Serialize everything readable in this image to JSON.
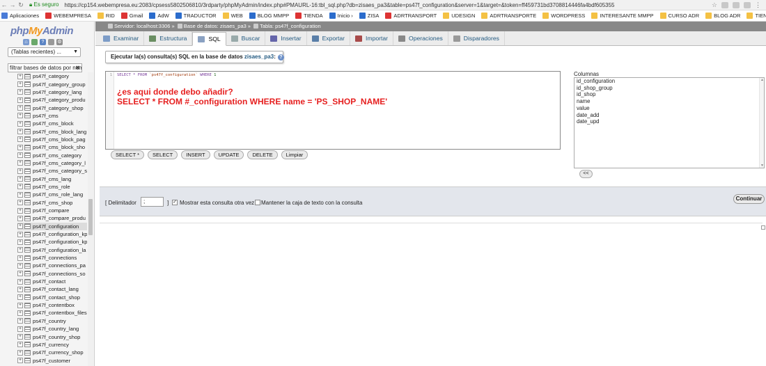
{
  "browser": {
    "secure_label": "Es seguro",
    "url": "https://cp154.webempresa.eu:2083/cpsess5802506810/3rdparty/phpMyAdmin/index.php#PMAURL-16:tbl_sql.php?db=zisaes_pa3&table=ps47f_configuration&server=1&target=&token=ff459731bd3708814446fa4bdf605355",
    "bookmarks": [
      {
        "label": "Aplicaciones",
        "icon": "apps-icon"
      },
      {
        "label": "WEBEMPRESA",
        "icon": "webempresa-icon"
      },
      {
        "label": "RID",
        "icon": "folder-icon"
      },
      {
        "label": "Gmail",
        "icon": "gmail-icon"
      },
      {
        "label": "AdW",
        "icon": "adwords-icon"
      },
      {
        "label": "TRADUCTOR",
        "icon": "translate-icon"
      },
      {
        "label": "WEB",
        "icon": "folder-icon"
      },
      {
        "label": "BLOG MMPP",
        "icon": "wordpress-icon"
      },
      {
        "label": "TIENDA",
        "icon": "prestashop-icon"
      },
      {
        "label": "Inicio ›",
        "icon": "home-icon"
      },
      {
        "label": "ZISA",
        "icon": "zisa-icon"
      },
      {
        "label": "ADRTRANSPORT",
        "icon": "adr-icon"
      },
      {
        "label": "UDESIGN",
        "icon": "folder-icon"
      },
      {
        "label": "ADRTRANSPORTE",
        "icon": "folder-icon"
      },
      {
        "label": "WORDPRESS",
        "icon": "folder-icon"
      },
      {
        "label": "INTERESANTE MMPP",
        "icon": "folder-icon"
      },
      {
        "label": "CURSO ADR",
        "icon": "folder-icon"
      },
      {
        "label": "BLOG ADR",
        "icon": "folder-icon"
      },
      {
        "label": "TIENDA ADR",
        "icon": "folder-icon"
      }
    ]
  },
  "sidebar": {
    "logo_php": "php",
    "logo_my": "My",
    "logo_admin": "Admin",
    "recent_label": "(Tablas recientes) ...",
    "filter_value": "filtrar bases de datos por nom",
    "tables": [
      "ps47f_category",
      "ps47f_category_group",
      "ps47f_category_lang",
      "ps47f_category_produ",
      "ps47f_category_shop",
      "ps47f_cms",
      "ps47f_cms_block",
      "ps47f_cms_block_lang",
      "ps47f_cms_block_pag",
      "ps47f_cms_block_sho",
      "ps47f_cms_category",
      "ps47f_cms_category_l",
      "ps47f_cms_category_s",
      "ps47f_cms_lang",
      "ps47f_cms_role",
      "ps47f_cms_role_lang",
      "ps47f_cms_shop",
      "ps47f_compare",
      "ps47f_compare_produ",
      "ps47f_configuration",
      "ps47f_configuration_kp",
      "ps47f_configuration_kp",
      "ps47f_configuration_la",
      "ps47f_connections",
      "ps47f_connections_pa",
      "ps47f_connections_so",
      "ps47f_contact",
      "ps47f_contact_lang",
      "ps47f_contact_shop",
      "ps47f_contentbox",
      "ps47f_contentbox_files",
      "ps47f_country",
      "ps47f_country_lang",
      "ps47f_country_shop",
      "ps47f_currency",
      "ps47f_currency_shop",
      "ps47f_customer"
    ],
    "selected_index": 19
  },
  "breadcrumb": {
    "server": "Servidor: localhost:3306",
    "database": "Base de datos: zisaes_pa3",
    "table": "Tabla: ps47f_configuration"
  },
  "tabs": [
    {
      "label": "Examinar",
      "icon": "browse-icon",
      "active": false
    },
    {
      "label": "Estructura",
      "icon": "structure-icon",
      "active": false
    },
    {
      "label": "SQL",
      "icon": "sql-icon",
      "active": true
    },
    {
      "label": "Buscar",
      "icon": "search-icon",
      "active": false
    },
    {
      "label": "Insertar",
      "icon": "insert-icon",
      "active": false
    },
    {
      "label": "Exportar",
      "icon": "export-icon",
      "active": false
    },
    {
      "label": "Importar",
      "icon": "import-icon",
      "active": false
    },
    {
      "label": "Operaciones",
      "icon": "wrench-icon",
      "active": false
    },
    {
      "label": "Disparadores",
      "icon": "triggers-icon",
      "active": false
    }
  ],
  "sql": {
    "heading_prefix": "Ejecutar la(s) consulta(s) SQL en la base de datos ",
    "heading_db": "zisaes_pa3",
    "heading_suffix": ":",
    "line_number": "1",
    "query_select": "SELECT * FROM ",
    "query_table": "`ps47f_configuration`",
    "query_where": " WHERE ",
    "query_value": "1",
    "note_line1": "¿es aqui donde debo añadir?",
    "note_line2": "SELECT * FROM #_configuration WHERE name = 'PS_SHOP_NAME'",
    "buttons": [
      "SELECT *",
      "SELECT",
      "INSERT",
      "UPDATE",
      "DELETE",
      "Limpiar"
    ],
    "columns_label": "Columnas",
    "columns": [
      "id_configuration",
      "id_shop_group",
      "id_shop",
      "name",
      "value",
      "date_add",
      "date_upd"
    ],
    "insert_column_btn": "<<"
  },
  "options": {
    "delimiter_label": "[ Delimitador",
    "delimiter_value": ";",
    "delimiter_close": "]",
    "show_again_label": "Mostrar esta consulta otra vez",
    "show_again_checked": true,
    "keep_box_label": "Mantener la caja de texto con la consulta",
    "keep_box_checked": false,
    "continue_label": "Continuar"
  },
  "colors": {
    "link_blue": "#235a81",
    "note_red": "#e62020",
    "breadcrumb_bg": "#888888",
    "options_bg": "#e3e6ec"
  }
}
